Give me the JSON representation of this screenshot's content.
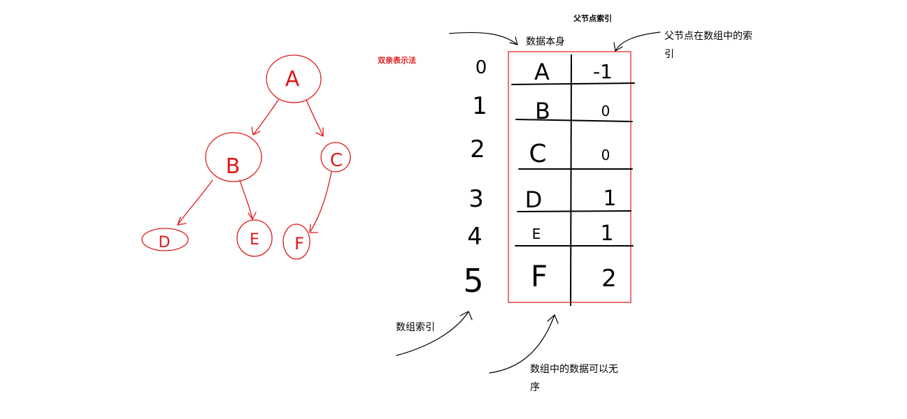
{
  "colors": {
    "ink": "#000000",
    "pen": "#e01818",
    "background": "#ffffff"
  },
  "method_title": "双亲表示法",
  "tree": {
    "nodes": [
      "A",
      "B",
      "C",
      "D",
      "E",
      "F"
    ],
    "edges": [
      [
        "A",
        "B"
      ],
      [
        "A",
        "C"
      ],
      [
        "B",
        "D"
      ],
      [
        "B",
        "E"
      ],
      [
        "C",
        "F"
      ]
    ]
  },
  "table": {
    "rows": [
      {
        "index": "0",
        "data": "A",
        "parent": "-1"
      },
      {
        "index": "1",
        "data": "B",
        "parent": "0"
      },
      {
        "index": "2",
        "data": "C",
        "parent": "0"
      },
      {
        "index": "3",
        "data": "D",
        "parent": "1"
      },
      {
        "index": "4",
        "data": "E",
        "parent": "1"
      },
      {
        "index": "5",
        "data": "F",
        "parent": "2"
      }
    ]
  },
  "annotations": {
    "top_parent_index": "父节点索引",
    "data_itself": "数据本身",
    "parent_in_array_line1": "父节点在数组中的索",
    "parent_in_array_line2": "引",
    "array_index": "数组索引",
    "unordered_line1": "数组中的数据可以无",
    "unordered_line2": "序"
  }
}
